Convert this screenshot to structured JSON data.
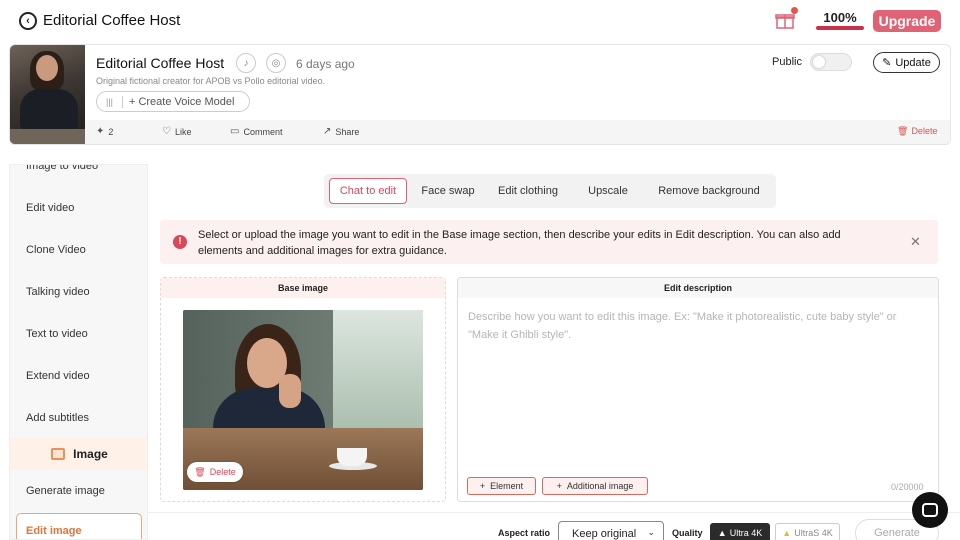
{
  "header": {
    "title": "Editorial Coffee Host",
    "credits_percent_label": "100%",
    "credits_percent": 100,
    "upgrade_label": "Upgrade"
  },
  "card": {
    "name": "Editorial Coffee Host",
    "time_ago": "6 days ago",
    "description": "Original fictional creator for APOB vs Pollo editorial video.",
    "voice_button_label": "Create Voice Model",
    "public_label": "Public",
    "public_on": false,
    "update_label": "Update",
    "footer": {
      "remix_count": "2",
      "like_label": "Like",
      "comment_label": "Comment",
      "share_label": "Share",
      "delete_label": "Delete"
    }
  },
  "sidebar": {
    "items": [
      {
        "label": "Image to video"
      },
      {
        "label": "Edit video"
      },
      {
        "label": "Clone Video"
      },
      {
        "label": "Talking video"
      },
      {
        "label": "Text to video"
      },
      {
        "label": "Extend video"
      },
      {
        "label": "Add subtitles"
      }
    ],
    "section_label": "Image",
    "image_items": [
      {
        "label": "Generate image"
      },
      {
        "label": "Edit image"
      }
    ]
  },
  "tabs": [
    {
      "label": "Chat to edit",
      "active": true
    },
    {
      "label": "Face swap",
      "active": false
    },
    {
      "label": "Edit clothing",
      "active": false
    },
    {
      "label": "Upscale",
      "active": false
    },
    {
      "label": "Remove background",
      "active": false
    }
  ],
  "banner": {
    "text": "Select or upload the image you want to edit in the Base image section, then describe your edits in Edit description. You can also add elements and additional images for extra guidance."
  },
  "base_image": {
    "title": "Base image",
    "delete_label": "Delete"
  },
  "edit_description": {
    "title": "Edit description",
    "placeholder": "Describe how you want to edit this image. Ex: \"Make it photorealistic, cute baby style\" or \"Make it Ghibli style\".",
    "element_label": "Element",
    "additional_image_label": "Additional image",
    "counter": "0/20000"
  },
  "bottom_bar": {
    "aspect_ratio_label": "Aspect ratio",
    "aspect_ratio_value": "Keep original",
    "quality_label": "Quality",
    "quality_options": [
      "Ultra 4K",
      "UltraS 4K"
    ],
    "generate_label": "Generate"
  },
  "colors": {
    "accent": "#e06275",
    "accent_dark": "#d8495f",
    "side_active": "#e0763a"
  }
}
